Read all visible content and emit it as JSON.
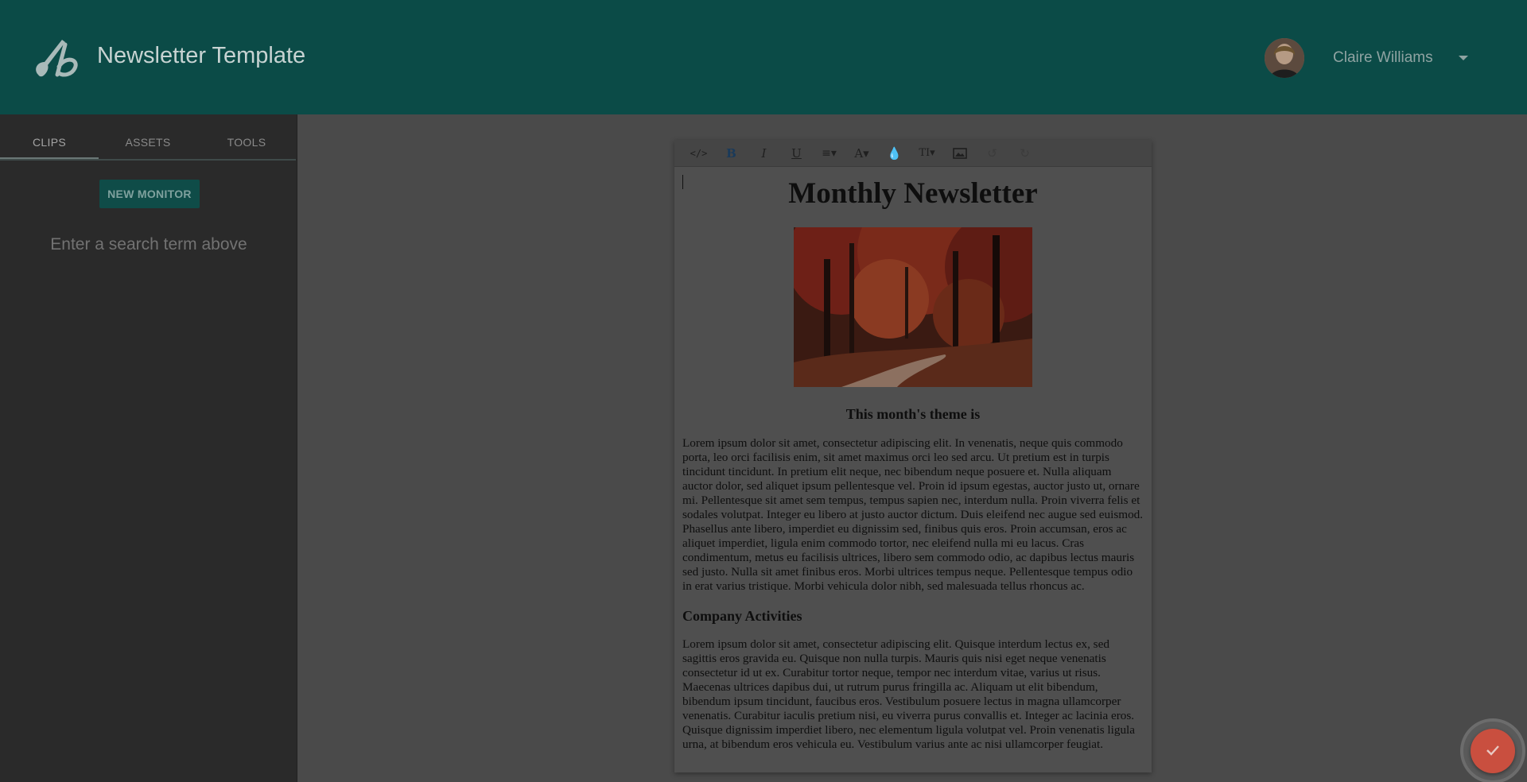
{
  "header": {
    "app_title": "Newsletter Template",
    "user_name": "Claire Williams"
  },
  "sidebar": {
    "tabs": [
      {
        "label": "CLIPS",
        "active": true
      },
      {
        "label": "ASSETS",
        "active": false
      },
      {
        "label": "TOOLS",
        "active": false
      }
    ],
    "new_monitor_label": "NEW MONITOR",
    "search_hint": "Enter a search term above"
  },
  "toolbar": {
    "buttons": [
      "code-view-icon",
      "bold-icon",
      "italic-icon",
      "underline-icon",
      "align-icon",
      "font-color-icon",
      "highlight-icon",
      "font-size-icon",
      "image-icon",
      "undo-icon",
      "redo-icon"
    ]
  },
  "document": {
    "title": "Monthly Newsletter",
    "theme_heading": "This month's theme is",
    "intro_paragraph": "Lorem ipsum dolor sit amet, consectetur adipiscing elit. In venenatis, neque quis commodo porta, leo orci facilisis enim, sit amet maximus orci leo sed arcu. Ut pretium est in turpis tincidunt tincidunt. In pretium elit neque, nec bibendum neque posuere et. Nulla aliquam auctor dolor, sed aliquet ipsum pellentesque vel. Proin id ipsum egestas, auctor justo ut, ornare mi. Pellentesque sit amet sem tempus, tempus sapien nec, interdum nulla. Proin viverra felis et sodales volutpat. Integer eu libero at justo auctor dictum. Duis eleifend nec augue sed euismod. Phasellus ante libero, imperdiet eu dignissim sed, finibus quis eros. Proin accumsan, eros ac aliquet imperdiet, ligula enim commodo tortor, nec eleifend nulla mi eu lacus. Cras condimentum, metus eu facilisis ultrices, libero sem commodo odio, ac dapibus lectus mauris sed justo. Nulla sit amet finibus eros. Morbi ultrices tempus neque. Pellentesque tempus odio in erat varius tristique. Morbi vehicula dolor nibh, sed malesuada tellus rhoncus ac.",
    "section_title": "Company Activities",
    "section_paragraph": "Lorem ipsum dolor sit amet, consectetur adipiscing elit. Quisque interdum lectus ex, sed sagittis eros gravida eu. Quisque non nulla turpis. Mauris quis nisi eget neque venenatis consectetur id ut ex. Curabitur tortor neque, tempor nec interdum vitae, varius ut risus. Maecenas ultrices dapibus dui, ut rutrum purus fringilla ac. Aliquam ut elit bibendum, bibendum ipsum tincidunt, faucibus eros. Vestibulum posuere lectus in magna ullamcorper venenatis. Curabitur iaculis pretium nisi, eu viverra purus convallis et. Integer ac lacinia eros. Quisque dignissim imperdiet libero, nec elementum ligula volutpat vel. Proin venenatis ligula urna, at bibendum eros vehicula eu. Vestibulum varius ante ac nisi ullamcorper feugiat."
  },
  "colors": {
    "header_bg": "#0b4b47",
    "fab": "#c94f3f",
    "overlay": "#4a4a4a"
  }
}
